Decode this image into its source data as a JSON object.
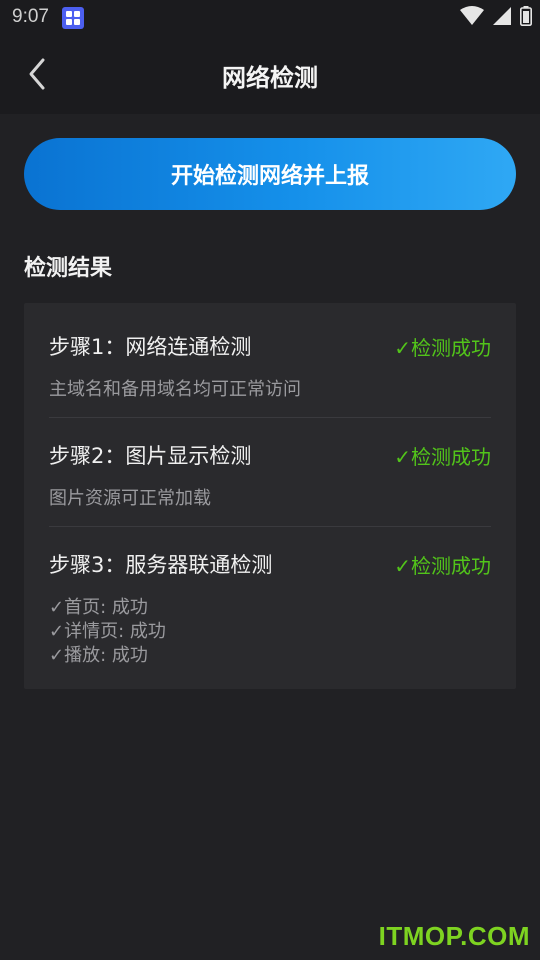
{
  "status_bar": {
    "time": "9:07",
    "app_icon": "grid-app-icon",
    "icons": [
      "wifi-icon",
      "cellular-signal-icon",
      "battery-icon"
    ]
  },
  "header": {
    "title": "网络检测",
    "back_icon": "chevron-left-icon"
  },
  "actions": {
    "detect_button_label": "开始检测网络并上报"
  },
  "results": {
    "section_title": "检测结果",
    "steps": [
      {
        "title": "步骤1：网络连通检测",
        "status": "✓检测成功",
        "description": "主域名和备用域名均可正常访问"
      },
      {
        "title": "步骤2：图片显示检测",
        "status": "✓检测成功",
        "description": "图片资源可正常加载"
      },
      {
        "title": "步骤3：服务器联通检测",
        "status": "✓检测成功",
        "items": [
          "✓首页: 成功",
          "✓详情页: 成功",
          "✓播放: 成功"
        ]
      }
    ]
  },
  "watermark": "ITMOP.COM",
  "colors": {
    "background": "#212124",
    "card": "#2a2a2d",
    "accent_blue": "#1590ea",
    "success_green": "#52c41a",
    "watermark_green": "#7ed321"
  }
}
